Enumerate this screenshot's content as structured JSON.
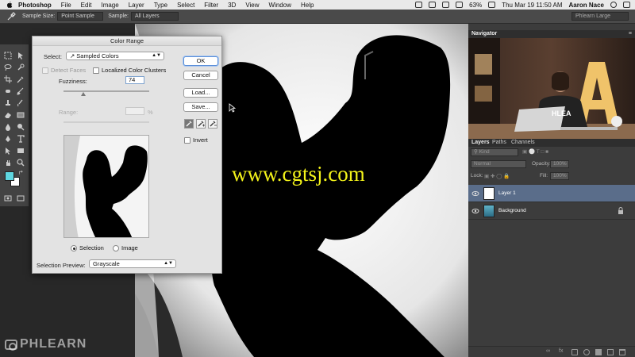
{
  "menubar": {
    "apple_icon": "apple-icon",
    "items": [
      "Photoshop",
      "File",
      "Edit",
      "Image",
      "Layer",
      "Type",
      "Select",
      "Filter",
      "3D",
      "View",
      "Window",
      "Help"
    ],
    "battery": "63%",
    "datetime": "Thu Mar 19  11:50 AM",
    "user": "Aaron Nace"
  },
  "options_bar": {
    "sample_size_label": "Sample Size:",
    "sample_size_value": "Point Sample",
    "sample_label": "Sample:",
    "sample_value": "All Layers",
    "workspace": "Phlearn Large"
  },
  "dialog": {
    "title": "Color Range",
    "select_label": "Select:",
    "select_value": "Sampled Colors",
    "detect_faces": "Detect Faces",
    "localized": "Localized Color Clusters",
    "fuzziness_label": "Fuzziness:",
    "fuzziness_value": "74",
    "range_label": "Range:",
    "range_unit": "%",
    "ok": "OK",
    "cancel": "Cancel",
    "load": "Load...",
    "save": "Save...",
    "invert": "Invert",
    "radio_selection": "Selection",
    "radio_image": "Image",
    "preview_label": "Selection Preview:",
    "preview_value": "Grayscale",
    "fuzziness_fraction": 0.23
  },
  "watermark": "www.cgtsj.com",
  "brand": "PHLEARN",
  "navigator": {
    "title": "Navigator",
    "laptop_text": "HLEA"
  },
  "layers_panel": {
    "tabs": [
      "Layers",
      "Paths",
      "Channels"
    ],
    "kind": "Kind",
    "blend_mode": "Normal",
    "opacity_label": "Opacity:",
    "opacity_value": "100%",
    "lock_label": "Lock:",
    "fill_label": "Fill:",
    "fill_value": "100%",
    "layers": [
      {
        "name": "Layer 1",
        "selected": true
      },
      {
        "name": "Background",
        "selected": false
      }
    ]
  },
  "colors": {
    "foreground": "#5fd7e0",
    "background": "#ffffff",
    "selected_layer": "#5a6d8a",
    "watermark": "#f4f41a"
  }
}
